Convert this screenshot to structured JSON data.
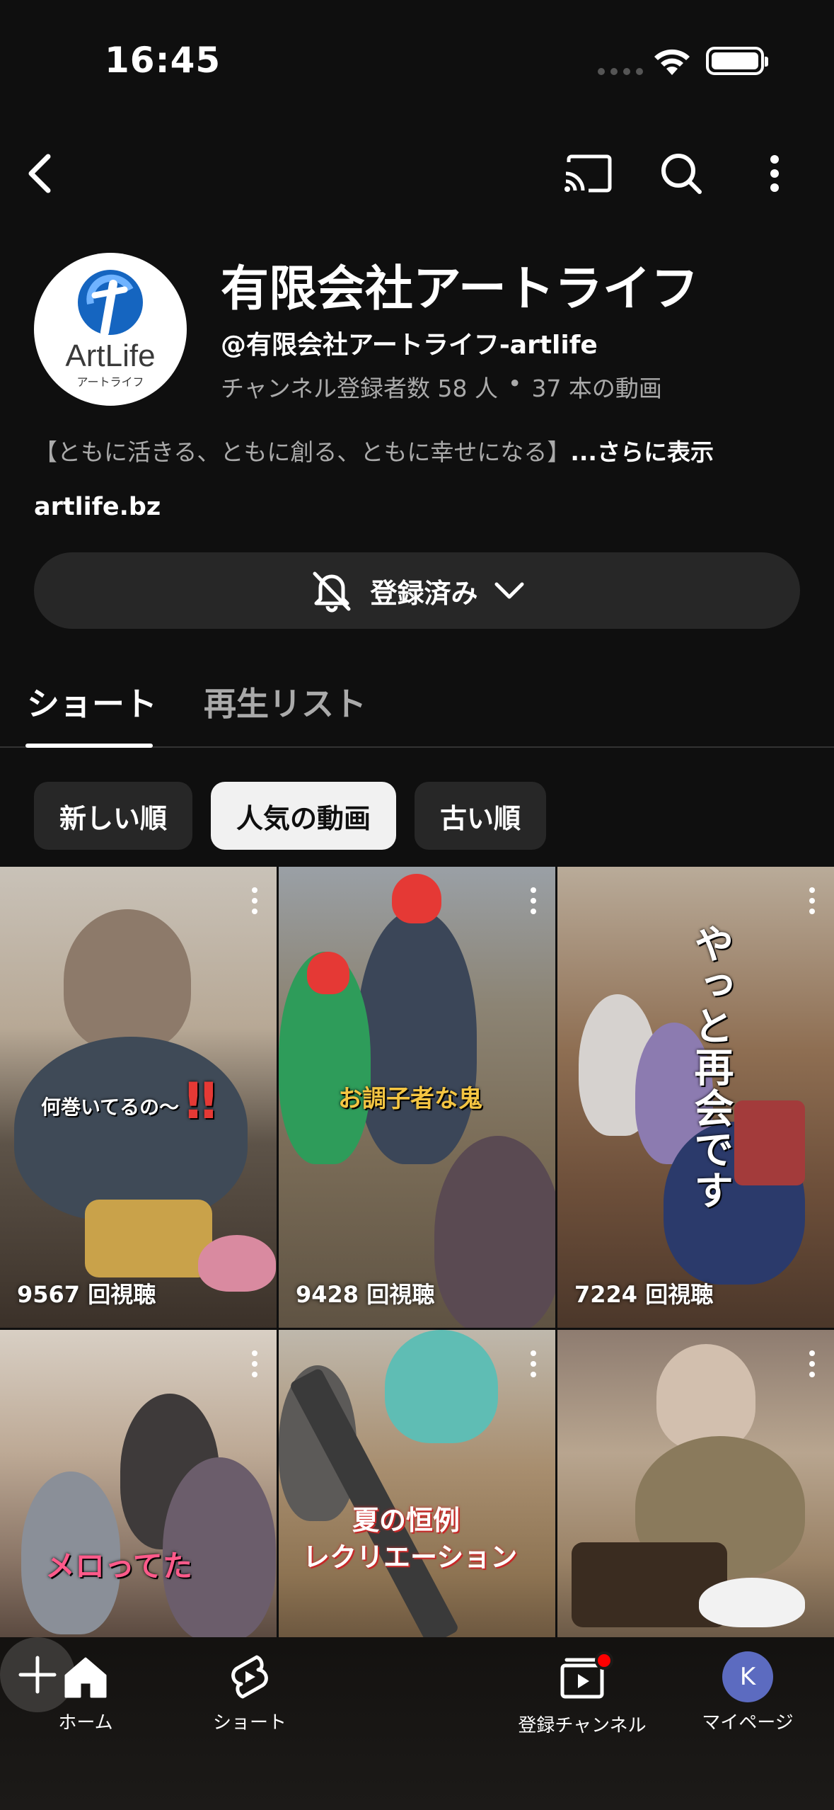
{
  "status_bar": {
    "time": "16:45"
  },
  "channel": {
    "name": "有限会社アートライフ",
    "handle": "@有限会社アートライフ-artlife",
    "subscribers": "チャンネル登録者数 58 人",
    "separator": "•",
    "video_count": "37 本の動画",
    "description": "【ともに活きる、ともに創る、ともに幸せになる】",
    "description_more": "...さらに表示",
    "link": "artlife.bz",
    "logo_text": "ArtLife",
    "logo_subtext": "アートライフ"
  },
  "subscribe_button": {
    "label": "登録済み"
  },
  "tabs": [
    {
      "label": "ショート",
      "active": true
    },
    {
      "label": "再生リスト",
      "active": false
    }
  ],
  "chips": [
    {
      "label": "新しい順",
      "active": false
    },
    {
      "label": "人気の動画",
      "active": true
    },
    {
      "label": "古い順",
      "active": false
    }
  ],
  "shorts": [
    {
      "caption": "何巻いてるの〜",
      "views": "9567 回視聴"
    },
    {
      "caption": "お調子者な鬼",
      "views": "9428 回視聴"
    },
    {
      "caption": "やっと再会です",
      "views": "7224 回視聴"
    },
    {
      "caption": "メロってた",
      "views": ""
    },
    {
      "caption": "夏の恒例",
      "caption2": "レクリエーション",
      "views": ""
    },
    {
      "caption": "",
      "views": ""
    }
  ],
  "bottom_nav": {
    "home": "ホーム",
    "shorts": "ショート",
    "subscriptions": "登録チャンネル",
    "you": "マイページ",
    "avatar_letter": "K"
  },
  "colors": {
    "background": "#0f0f0f",
    "chip_active": "#f1f1f1",
    "chip_inactive": "#272727",
    "notification_dot": "#ff0000",
    "avatar": "#5c6bc0",
    "logo_blue": "#1565c0"
  }
}
